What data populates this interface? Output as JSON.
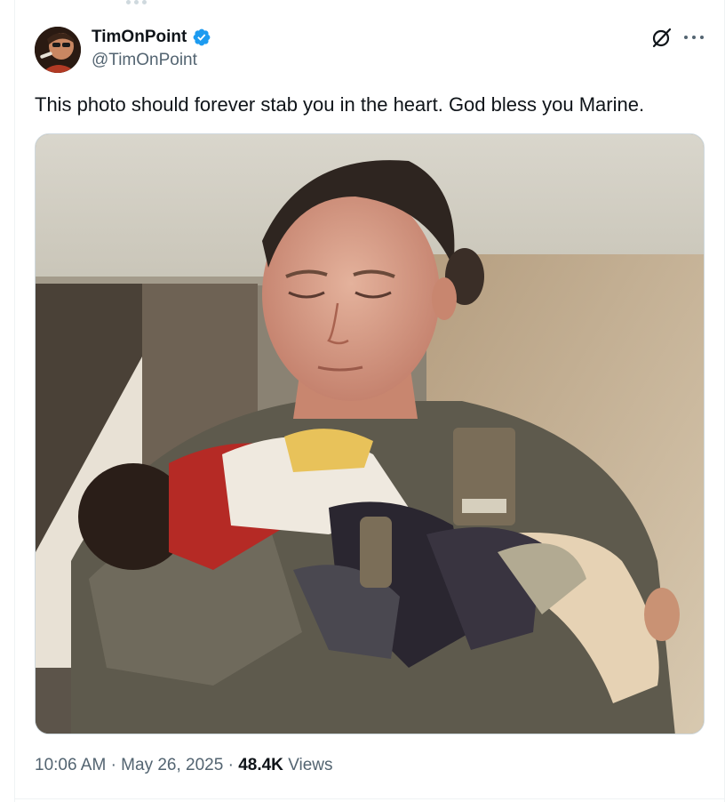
{
  "tweet": {
    "author": {
      "display_name": "TimOnPoint",
      "handle": "@TimOnPoint",
      "verified": true,
      "verified_color": "#1d9bf0"
    },
    "text": "This photo should forever stab you in the heart. God bless you Marine.",
    "media": {
      "type": "photo"
    },
    "time": "10:06 AM",
    "separator": "·",
    "date": "May 26, 2025",
    "views_count": "48.4K",
    "views_label": "Views"
  },
  "icons": {
    "verified": "verified-badge-icon",
    "grok": "grok-icon",
    "more": "more-options-icon"
  },
  "colors": {
    "text_primary": "#0f1419",
    "text_secondary": "#536471",
    "accent": "#1d9bf0"
  }
}
